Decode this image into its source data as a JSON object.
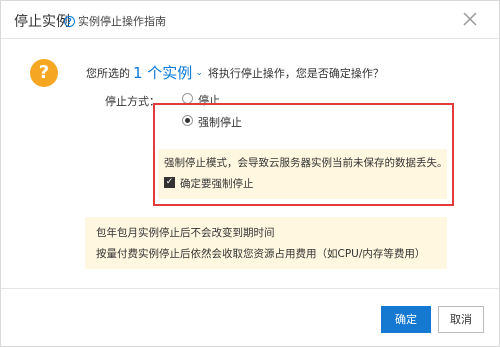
{
  "dialog": {
    "title": "停止实例",
    "guide_link": "实例停止操作指南"
  },
  "question": {
    "prefix": "您所选的",
    "count": "1 个实例",
    "suffix": "将执行停止操作，您是否确定操作？"
  },
  "stop_mode": {
    "label": "停止方式：",
    "options": [
      "停止",
      "强制停止"
    ],
    "selected": "强制停止"
  },
  "force_warning": {
    "text": "强制停止模式，会导致云服务器实例当前未保存的数据丢失。",
    "confirm_label": "确定要强制停止",
    "confirm_checked": true
  },
  "info": {
    "line1": "包年包月实例停止后不会改变到期时间",
    "line2": "按量付费实例停止后依然会收取您资源占用费用（如CPU/内存等费用）"
  },
  "buttons": {
    "ok": "确定",
    "cancel": "取消"
  },
  "colors": {
    "accent": "#1579d2",
    "warning": "#f5a623",
    "highlight_border": "#e23b3b",
    "note_bg": "#fff7df"
  }
}
